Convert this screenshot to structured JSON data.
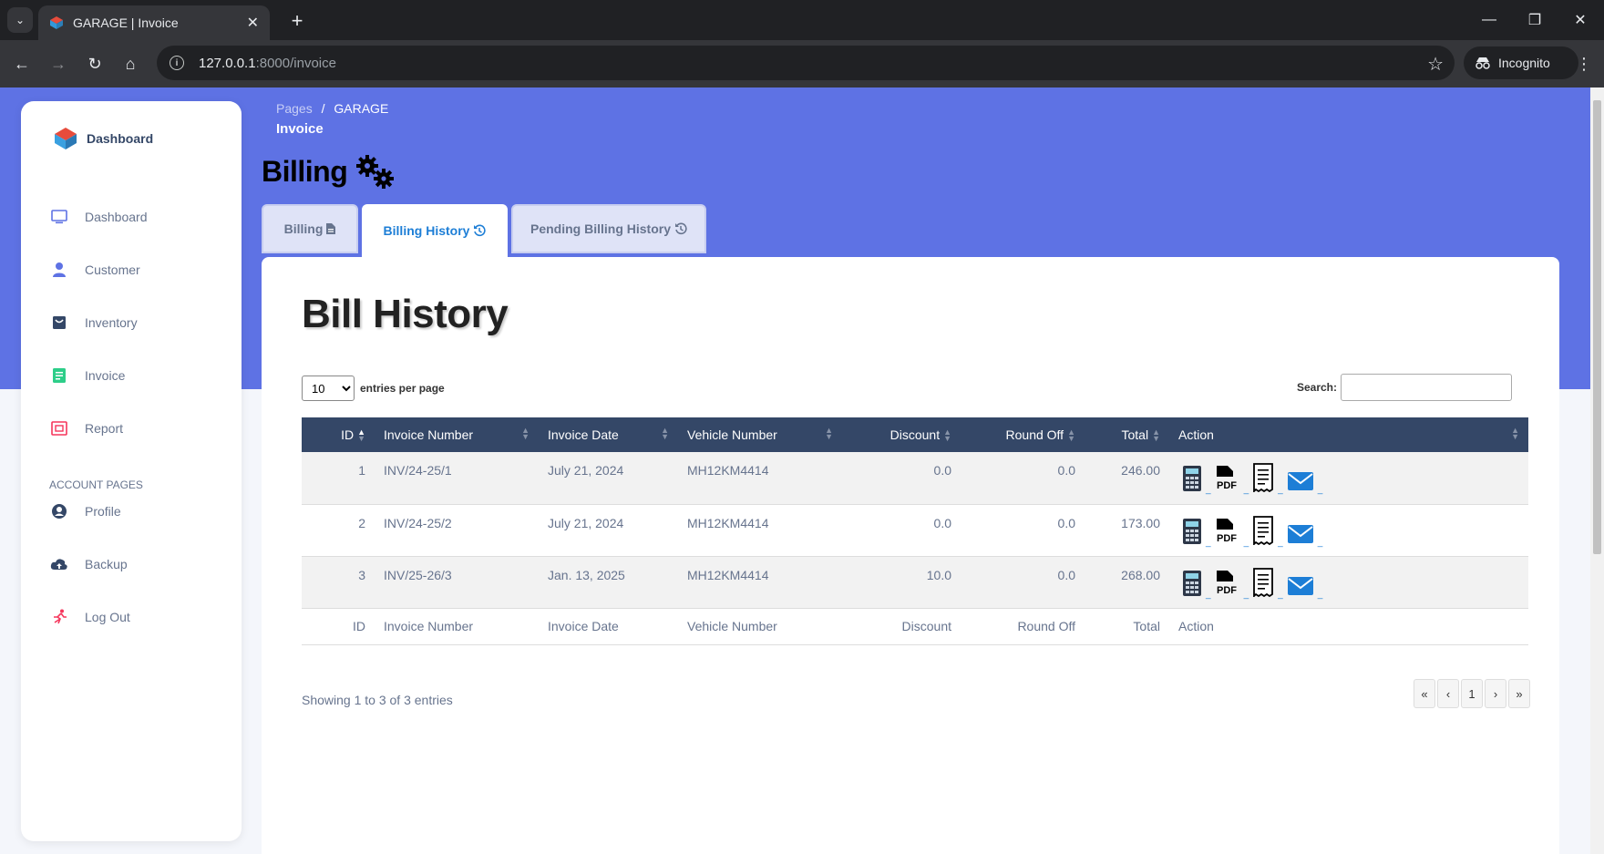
{
  "browser": {
    "tab_title": "GARAGE | Invoice",
    "url_host": "127.0.0.1",
    "url_rest": ":8000/invoice",
    "profile": "Incognito"
  },
  "sidebar": {
    "brand": "Dashboard",
    "items": [
      {
        "label": "Dashboard",
        "icon": "monitor-icon",
        "color": "#5e72e4"
      },
      {
        "label": "Customer",
        "icon": "user-icon",
        "color": "#5e72e4"
      },
      {
        "label": "Inventory",
        "icon": "box-icon",
        "color": "#344767"
      },
      {
        "label": "Invoice",
        "icon": "invoice-icon",
        "color": "#2dce89"
      },
      {
        "label": "Report",
        "icon": "report-icon",
        "color": "#f5365c"
      }
    ],
    "section_label": "ACCOUNT PAGES",
    "account_items": [
      {
        "label": "Profile",
        "icon": "profile-icon"
      },
      {
        "label": "Backup",
        "icon": "cloud-upload-icon"
      },
      {
        "label": "Log Out",
        "icon": "logout-icon"
      }
    ]
  },
  "breadcrumb": {
    "root": "Pages",
    "separator": "/",
    "current": "GARAGE",
    "title": "Invoice"
  },
  "page": {
    "title": "Billing",
    "tabs": [
      {
        "label": "Billing",
        "icon": "file-icon"
      },
      {
        "label": "Billing History",
        "icon": "history-icon"
      },
      {
        "label": "Pending Billing History",
        "icon": "history-icon"
      }
    ],
    "active_tab": 1
  },
  "table_section": {
    "heading": "Bill History",
    "page_length": "10",
    "length_label": "entries per page",
    "search_label": "Search:",
    "search_value": "",
    "columns": [
      "ID",
      "Invoice Number",
      "Invoice Date",
      "Vehicle Number",
      "Discount",
      "Round Off",
      "Total",
      "Action"
    ],
    "rows": [
      {
        "id": "1",
        "invoice": "INV/24-25/1",
        "date": "July 21, 2024",
        "vehicle": "MH12KM4414",
        "discount": "0.0",
        "round_off": "0.0",
        "total": "246.00"
      },
      {
        "id": "2",
        "invoice": "INV/24-25/2",
        "date": "July 21, 2024",
        "vehicle": "MH12KM4414",
        "discount": "0.0",
        "round_off": "0.0",
        "total": "173.00"
      },
      {
        "id": "3",
        "invoice": "INV/25-26/3",
        "date": "Jan. 13, 2025",
        "vehicle": "MH12KM4414",
        "discount": "10.0",
        "round_off": "0.0",
        "total": "268.00"
      }
    ],
    "info": "Showing 1 to 3 of 3 entries",
    "pager": [
      "«",
      "‹",
      "1",
      "›",
      "»"
    ],
    "action_icons": [
      "calculator-icon",
      "pdf-icon",
      "receipt-icon",
      "email-icon"
    ],
    "accent": "#344767"
  }
}
